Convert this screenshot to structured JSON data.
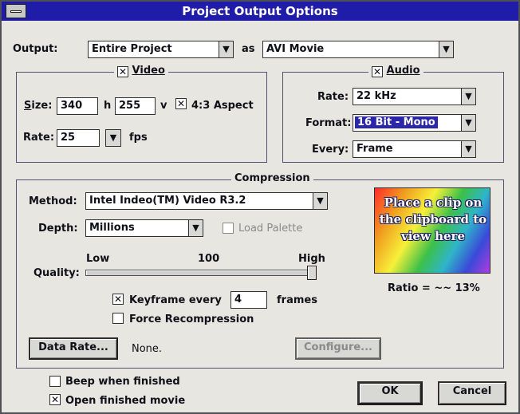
{
  "window": {
    "title": "Project Output Options"
  },
  "output": {
    "label": "Output:",
    "value": "Entire Project",
    "as_label": "as",
    "format_value": "AVI Movie"
  },
  "video": {
    "group_label": "Video",
    "checked": true,
    "size_label": "Size:",
    "width": "340",
    "h_label": "h",
    "height": "255",
    "v_label": "v",
    "aspect_label": "4:3 Aspect",
    "aspect_checked": true,
    "rate_label": "Rate:",
    "rate": "25",
    "fps_label": "fps"
  },
  "audio": {
    "group_label": "Audio",
    "checked": true,
    "rate_label": "Rate:",
    "rate": "22 kHz",
    "format_label": "Format:",
    "format": "16 Bit - Mono",
    "every_label": "Every:",
    "every": "Frame"
  },
  "compression": {
    "group_label": "Compression",
    "method_label": "Method:",
    "method": "Intel Indeo(TM) Video R3.2",
    "depth_label": "Depth:",
    "depth": "Millions",
    "load_palette_label": "Load Palette",
    "load_palette_checked": false,
    "quality_label": "Quality:",
    "quality_low": "Low",
    "quality_value": "100",
    "quality_high": "High",
    "quality_fraction": 1.0,
    "keyframe_label": "Keyframe every",
    "keyframe_checked": true,
    "keyframe_value": "4",
    "frames_label": "frames",
    "force_recompress_label": "Force Recompression",
    "force_recompress_checked": false,
    "data_rate_button": "Data Rate...",
    "data_rate_value": "None.",
    "configure_button": "Configure...",
    "preview_text": "Place a clip on the clipboard to view here",
    "ratio_text": "Ratio = ~~ 13%"
  },
  "options": {
    "beep_label": "Beep when finished",
    "beep_checked": false,
    "open_label": "Open finished movie",
    "open_checked": true
  },
  "buttons": {
    "ok": "OK",
    "cancel": "Cancel"
  },
  "icons": {
    "dropdown": "down-arrow-icon",
    "check": "x-check-icon",
    "system_menu": "system-menu-icon"
  },
  "colors": {
    "titlebar": "#1f1caa",
    "selection": "#2a27a8",
    "face": "#e7e6e1"
  }
}
